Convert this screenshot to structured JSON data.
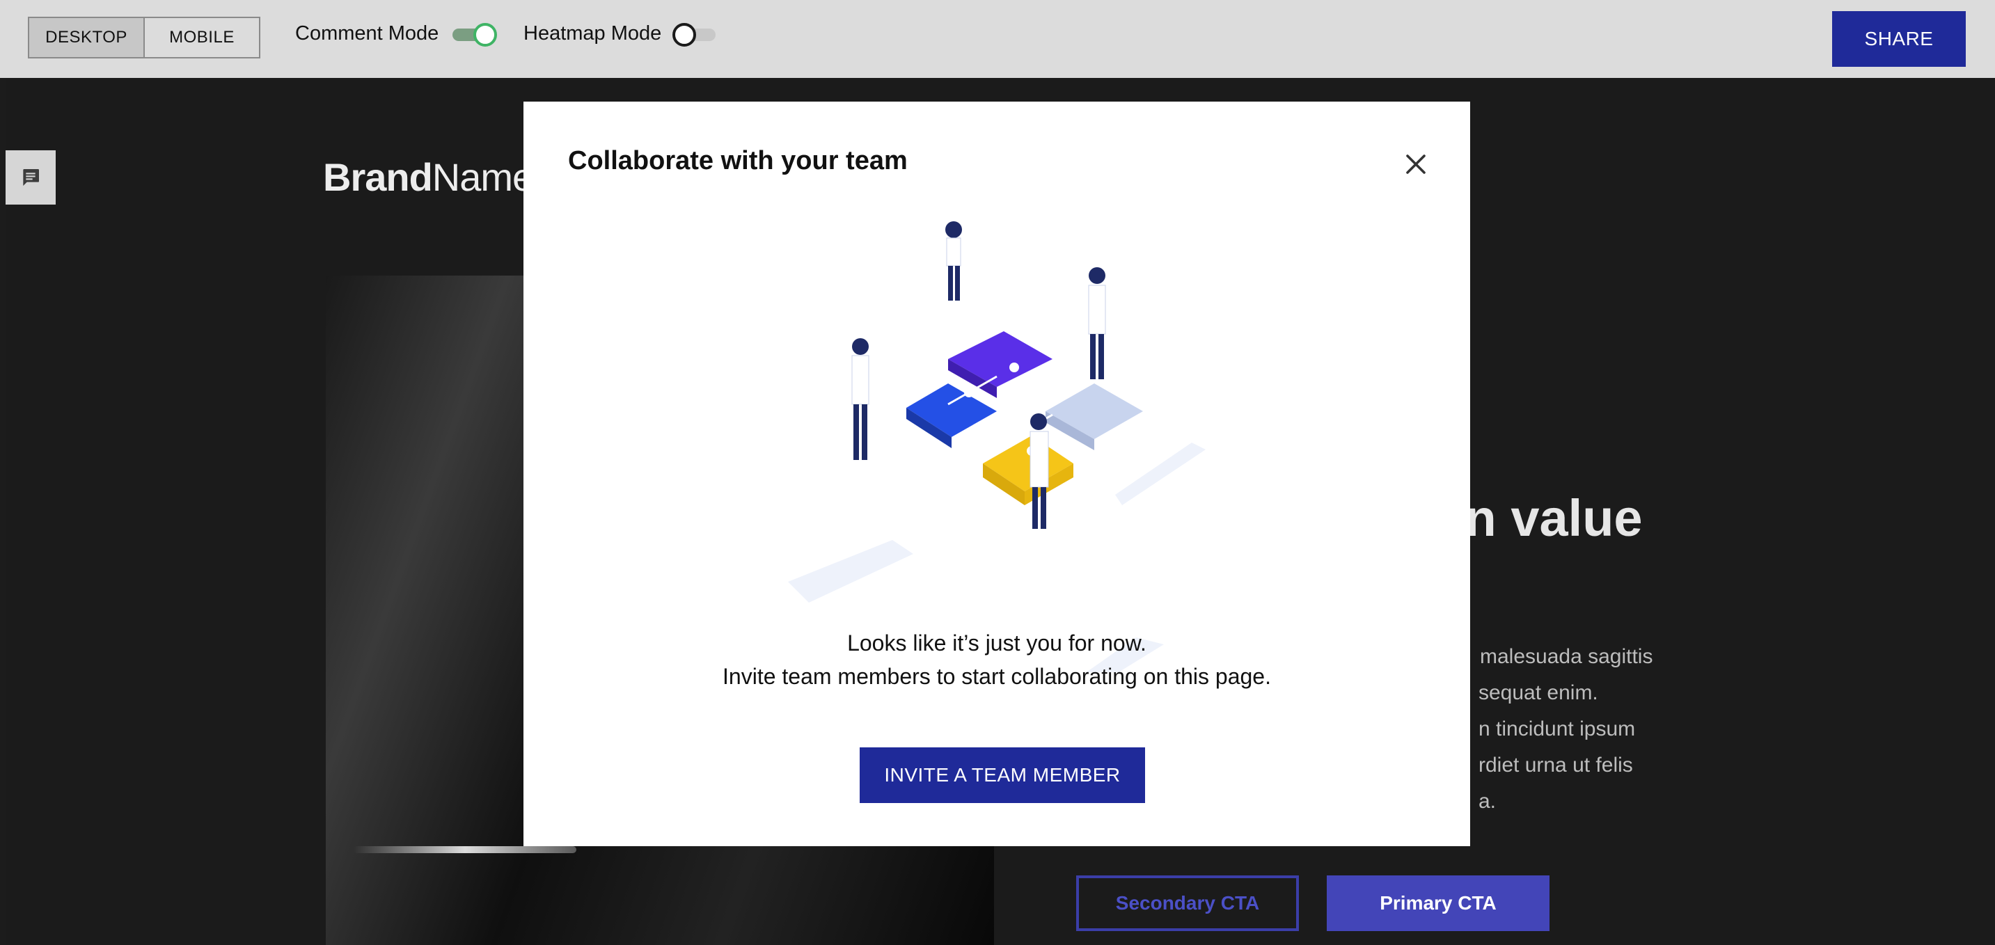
{
  "toolbar": {
    "view_tabs": [
      {
        "label": "DESKTOP",
        "active": true
      },
      {
        "label": "MOBILE",
        "active": false
      }
    ],
    "comment_mode": {
      "label": "Comment Mode",
      "on": true
    },
    "heatmap_mode": {
      "label": "Heatmap Mode",
      "on": false
    },
    "share_label": "SHARE"
  },
  "page": {
    "brand_bold": "Brand",
    "brand_light": "Name",
    "headline_fragment": "in value",
    "paragraph_fragments": [
      "malesuada sagittis",
      "sequat enim.",
      "n tincidunt ipsum",
      "rdiet urna ut felis",
      "a."
    ],
    "secondary_cta": "Secondary CTA",
    "primary_cta": "Primary CTA"
  },
  "modal": {
    "title": "Collaborate with your team",
    "message_line1": "Looks like it’s just you for now.",
    "message_line2": "Invite team members to start collaborating on this page.",
    "invite_label": "INVITE A TEAM MEMBER"
  },
  "colors": {
    "accent": "#1f2a99",
    "toggle_on": "#3fb465",
    "puzzle_blue": "#2450e6",
    "puzzle_purple": "#5a2fe8",
    "puzzle_yellow": "#f5c518",
    "puzzle_light": "#c8d4ee"
  },
  "icons": [
    "comment-icon",
    "close-icon"
  ]
}
